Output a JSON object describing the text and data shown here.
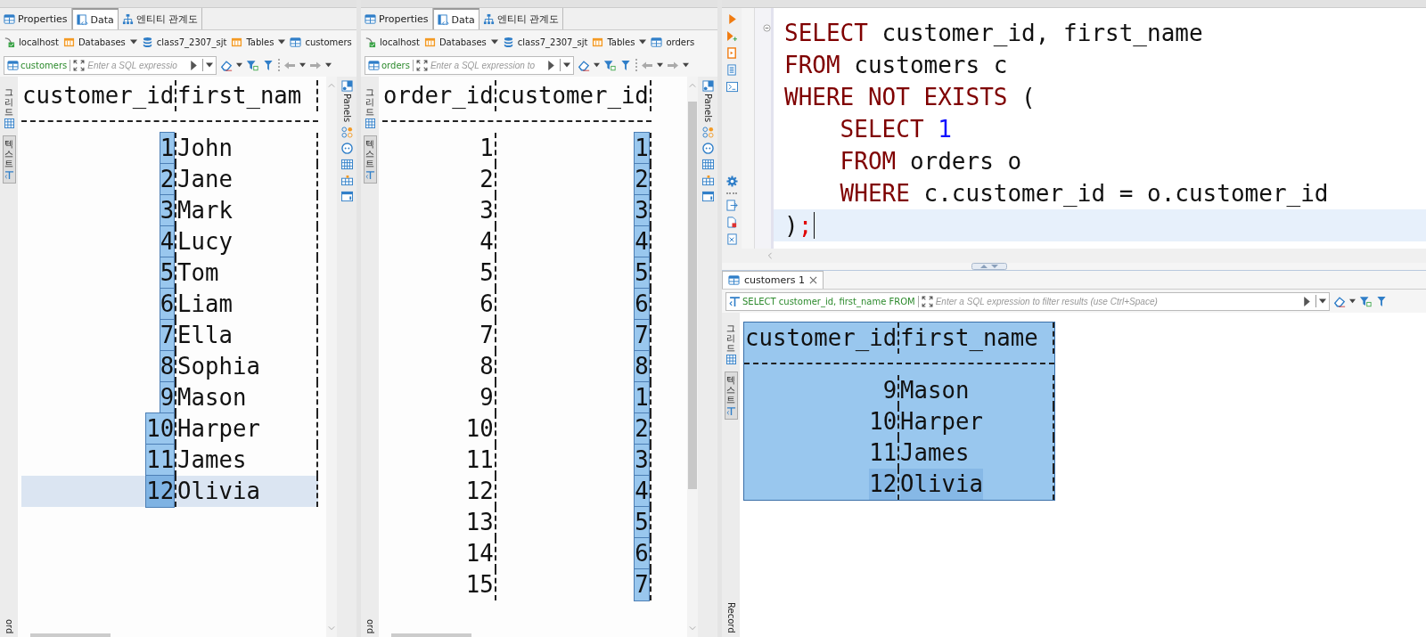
{
  "panels": [
    {
      "tabs": [
        {
          "label": "Properties",
          "selected": false
        },
        {
          "label": "Data",
          "selected": true
        },
        {
          "label": "엔티티 관계도",
          "selected": false
        }
      ],
      "breadcrumb": [
        {
          "label": "localhost",
          "kind": "connection"
        },
        {
          "label": "Databases",
          "kind": "folder",
          "dropdown": true
        },
        {
          "label": "class7_2307_sjt",
          "kind": "database"
        },
        {
          "label": "Tables",
          "kind": "folder",
          "dropdown": true
        },
        {
          "label": "customers",
          "kind": "table"
        }
      ],
      "filter": {
        "source": "customers",
        "placeholder": "Enter a SQL expressio"
      },
      "view_tabs": [
        {
          "label": "그리드",
          "selected": false
        },
        {
          "label": "텍스트",
          "selected": true
        }
      ],
      "record_label": "ord",
      "panels_label": "Panels",
      "scroll_thumb": false,
      "table": {
        "header_selected": false,
        "columns": [
          {
            "title": "customer_id",
            "kind": "number",
            "selected": true
          },
          {
            "title": "first_nam",
            "kind": "text",
            "selected": false
          }
        ],
        "rows": [
          {
            "cells": [
              "1",
              "John"
            ],
            "current": false
          },
          {
            "cells": [
              "2",
              "Jane"
            ],
            "current": false
          },
          {
            "cells": [
              "3",
              "Mark"
            ],
            "current": false
          },
          {
            "cells": [
              "4",
              "Lucy"
            ],
            "current": false
          },
          {
            "cells": [
              "5",
              "Tom"
            ],
            "current": false
          },
          {
            "cells": [
              "6",
              "Liam"
            ],
            "current": false
          },
          {
            "cells": [
              "7",
              "Ella"
            ],
            "current": false
          },
          {
            "cells": [
              "8",
              "Sophia"
            ],
            "current": false
          },
          {
            "cells": [
              "9",
              "Mason"
            ],
            "current": false
          },
          {
            "cells": [
              "10",
              "Harper"
            ],
            "current": false
          },
          {
            "cells": [
              "11",
              "James"
            ],
            "current": false
          },
          {
            "cells": [
              "12",
              "Olivia"
            ],
            "current": true
          }
        ]
      }
    },
    {
      "tabs": [
        {
          "label": "Properties",
          "selected": false
        },
        {
          "label": "Data",
          "selected": true
        },
        {
          "label": "엔티티 관계도",
          "selected": false
        }
      ],
      "breadcrumb": [
        {
          "label": "localhost",
          "kind": "connection"
        },
        {
          "label": "Databases",
          "kind": "folder",
          "dropdown": true
        },
        {
          "label": "class7_2307_sjt",
          "kind": "database"
        },
        {
          "label": "Tables",
          "kind": "folder",
          "dropdown": true
        },
        {
          "label": "orders",
          "kind": "table"
        }
      ],
      "filter": {
        "source": "orders",
        "placeholder": "Enter a SQL expression to"
      },
      "view_tabs": [
        {
          "label": "그리드",
          "selected": false
        },
        {
          "label": "텍스트",
          "selected": true
        }
      ],
      "record_label": "ord",
      "panels_label": "Panels",
      "scroll_thumb": true,
      "table": {
        "header_selected": false,
        "columns": [
          {
            "title": "order_id",
            "kind": "number",
            "selected": false
          },
          {
            "title": "customer_id",
            "kind": "number",
            "selected": true
          }
        ],
        "rows": [
          {
            "cells": [
              "1",
              "1"
            ],
            "current": false
          },
          {
            "cells": [
              "2",
              "2"
            ],
            "current": false
          },
          {
            "cells": [
              "3",
              "3"
            ],
            "current": false
          },
          {
            "cells": [
              "4",
              "4"
            ],
            "current": false
          },
          {
            "cells": [
              "5",
              "5"
            ],
            "current": false
          },
          {
            "cells": [
              "6",
              "6"
            ],
            "current": false
          },
          {
            "cells": [
              "7",
              "7"
            ],
            "current": false
          },
          {
            "cells": [
              "8",
              "8"
            ],
            "current": false
          },
          {
            "cells": [
              "9",
              "1"
            ],
            "current": false
          },
          {
            "cells": [
              "10",
              "2"
            ],
            "current": false
          },
          {
            "cells": [
              "11",
              "3"
            ],
            "current": false
          },
          {
            "cells": [
              "12",
              "4"
            ],
            "current": false
          },
          {
            "cells": [
              "13",
              "5"
            ],
            "current": false
          },
          {
            "cells": [
              "14",
              "6"
            ],
            "current": false
          },
          {
            "cells": [
              "15",
              "7"
            ],
            "current": false
          }
        ]
      }
    }
  ],
  "editor": {
    "lines": [
      {
        "current": false,
        "tokens": [
          {
            "text": "SELECT",
            "kind": "keyword"
          },
          {
            "text": " customer_id, first_name",
            "kind": "plain"
          }
        ]
      },
      {
        "current": false,
        "tokens": [
          {
            "text": "FROM",
            "kind": "keyword"
          },
          {
            "text": " customers c",
            "kind": "plain"
          }
        ]
      },
      {
        "current": false,
        "tokens": [
          {
            "text": "WHERE NOT EXISTS",
            "kind": "keyword"
          },
          {
            "text": " (",
            "kind": "plain"
          }
        ]
      },
      {
        "current": false,
        "tokens": [
          {
            "text": "    SELECT",
            "kind": "keyword"
          },
          {
            "text": " 1",
            "kind": "number"
          }
        ]
      },
      {
        "current": false,
        "tokens": [
          {
            "text": "    FROM",
            "kind": "keyword"
          },
          {
            "text": " orders o",
            "kind": "plain"
          }
        ]
      },
      {
        "current": false,
        "tokens": [
          {
            "text": "    WHERE",
            "kind": "keyword"
          },
          {
            "text": " c.customer_id = o.customer_id",
            "kind": "plain"
          }
        ]
      },
      {
        "current": true,
        "tokens": [
          {
            "text": ")",
            "kind": "plain"
          },
          {
            "text": ";",
            "kind": "punct"
          }
        ]
      }
    ]
  },
  "results": {
    "tab": {
      "label": "customers 1",
      "selected": true
    },
    "filter": {
      "query": "SELECT customer_id, first_name FROM",
      "placeholder": "Enter a SQL expression to filter results (use Ctrl+Space)"
    },
    "view_tabs": [
      {
        "label": "그리드",
        "selected": false
      },
      {
        "label": "텍스트",
        "selected": true
      }
    ],
    "record_label": "Record",
    "table": {
      "header_selected": true,
      "columns": [
        {
          "title": "customer_id",
          "kind": "number",
          "selected": true
        },
        {
          "title": "first_name",
          "kind": "text",
          "selected": true
        }
      ],
      "rows": [
        {
          "cells": [
            "9",
            "Mason"
          ],
          "current": false
        },
        {
          "cells": [
            "10",
            "Harper"
          ],
          "current": false
        },
        {
          "cells": [
            "11",
            "James"
          ],
          "current": false
        },
        {
          "cells": [
            "12",
            "Olivia"
          ],
          "current": true
        }
      ]
    }
  }
}
